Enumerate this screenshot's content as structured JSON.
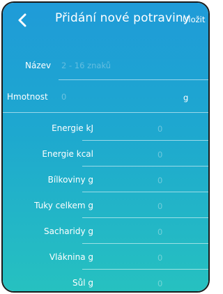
{
  "header": {
    "back_icon": "chevron-left-icon",
    "title": "Přidání nové potraviny",
    "save_label": "Uložit"
  },
  "form": {
    "name": {
      "label": "Název",
      "placeholder": "2 - 16 znaků"
    },
    "weight": {
      "label": "Hmotnost",
      "value": "0",
      "unit": "g"
    }
  },
  "nutrients": [
    {
      "label": "Energie kJ",
      "value": "0"
    },
    {
      "label": "Energie kcal",
      "value": "0"
    },
    {
      "label": "Bílkoviny g",
      "value": "0"
    },
    {
      "label": "Tuky celkem g",
      "value": "0"
    },
    {
      "label": "Sacharidy g",
      "value": "0"
    },
    {
      "label": "Vláknina g",
      "value": "0"
    },
    {
      "label": "Sůl g",
      "value": "0"
    }
  ],
  "colors": {
    "gradient_top": "#1f9bd8",
    "gradient_bottom": "#26c1c0",
    "text": "#ffffff"
  }
}
